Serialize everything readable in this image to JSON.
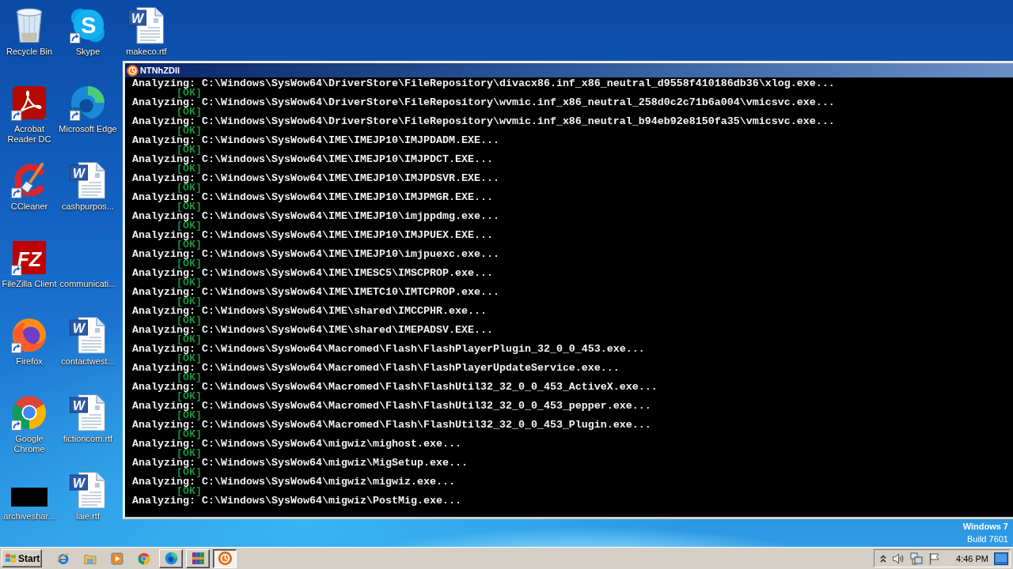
{
  "desktop": {
    "icon_rows": [
      {
        "icons": [
          {
            "kind": "recycle-bin",
            "label": "Recycle Bin",
            "shortcut": false,
            "selected": false
          },
          {
            "kind": "skype",
            "label": "Skype",
            "glyph": "S",
            "shortcut": true,
            "selected": false
          },
          {
            "kind": "word-doc",
            "label": "makeco.rtf",
            "glyph": "W",
            "shortcut": false,
            "selected": false
          }
        ]
      },
      {
        "icons": [
          {
            "kind": "acrobat",
            "label": "Acrobat Reader DC",
            "shortcut": true,
            "selected": false
          },
          {
            "kind": "edge",
            "label": "Microsoft Edge",
            "shortcut": true,
            "selected": false
          }
        ]
      },
      {
        "icons": [
          {
            "kind": "ccleaner",
            "label": "CCleaner",
            "shortcut": true,
            "selected": false
          },
          {
            "kind": "word-doc",
            "label": "cashpurpos...",
            "glyph": "W",
            "shortcut": false,
            "selected": false
          }
        ]
      },
      {
        "icons": [
          {
            "kind": "filezilla",
            "label": "FileZilla Client",
            "glyph": "FZ",
            "shortcut": true,
            "selected": false
          },
          {
            "kind": "blank",
            "label": "communicati...",
            "selected": false
          }
        ]
      },
      {
        "icons": [
          {
            "kind": "firefox",
            "label": "Firefox",
            "shortcut": true,
            "selected": false
          },
          {
            "kind": "word-doc",
            "label": "contactwest...",
            "glyph": "W",
            "shortcut": false,
            "selected": false
          }
        ]
      },
      {
        "icons": [
          {
            "kind": "chrome",
            "label": "Google Chrome",
            "shortcut": true,
            "selected": false
          },
          {
            "kind": "word-doc",
            "label": "fictioncom.rtf",
            "glyph": "W",
            "shortcut": false,
            "selected": false
          }
        ]
      },
      {
        "icons": [
          {
            "kind": "thumbnail",
            "label": "archiveshar...",
            "shortcut": false,
            "selected": false
          },
          {
            "kind": "word-doc",
            "label": "laie.rtf",
            "glyph": "W",
            "shortcut": false,
            "selected": false
          }
        ]
      }
    ],
    "system_watermark": {
      "edition": "Windows 7",
      "build": "Build 7601"
    }
  },
  "console_window": {
    "title": "NTNhZDll",
    "lines": [
      {
        "kind": "analysis",
        "text": "Analyzing: C:\\Windows\\SysWow64\\DriverStore\\FileRepository\\divacx86.inf_x86_neutral_d9558f410186db36\\xlog.exe..."
      },
      {
        "kind": "ok",
        "text": "[OK]"
      },
      {
        "kind": "analysis",
        "text": "Analyzing: C:\\Windows\\SysWow64\\DriverStore\\FileRepository\\wvmic.inf_x86_neutral_258d0c2c71b6a004\\vmicsvc.exe..."
      },
      {
        "kind": "ok",
        "text": "[OK]"
      },
      {
        "kind": "analysis",
        "text": "Analyzing: C:\\Windows\\SysWow64\\DriverStore\\FileRepository\\wvmic.inf_x86_neutral_b94eb92e8150fa35\\vmicsvc.exe..."
      },
      {
        "kind": "ok",
        "text": "[OK]"
      },
      {
        "kind": "analysis",
        "text": "Analyzing: C:\\Windows\\SysWow64\\IME\\IMEJP10\\IMJPDADM.EXE..."
      },
      {
        "kind": "ok",
        "text": "[OK]"
      },
      {
        "kind": "analysis",
        "text": "Analyzing: C:\\Windows\\SysWow64\\IME\\IMEJP10\\IMJPDCT.EXE..."
      },
      {
        "kind": "ok",
        "text": "[OK]"
      },
      {
        "kind": "analysis",
        "text": "Analyzing: C:\\Windows\\SysWow64\\IME\\IMEJP10\\IMJPDSVR.EXE..."
      },
      {
        "kind": "ok",
        "text": "[OK]"
      },
      {
        "kind": "analysis",
        "text": "Analyzing: C:\\Windows\\SysWow64\\IME\\IMEJP10\\IMJPMGR.EXE..."
      },
      {
        "kind": "ok",
        "text": "[OK]"
      },
      {
        "kind": "analysis",
        "text": "Analyzing: C:\\Windows\\SysWow64\\IME\\IMEJP10\\imjppdmg.exe..."
      },
      {
        "kind": "ok",
        "text": "[OK]"
      },
      {
        "kind": "analysis",
        "text": "Analyzing: C:\\Windows\\SysWow64\\IME\\IMEJP10\\IMJPUEX.EXE..."
      },
      {
        "kind": "ok",
        "text": "[OK]"
      },
      {
        "kind": "analysis",
        "text": "Analyzing: C:\\Windows\\SysWow64\\IME\\IMEJP10\\imjpuexc.exe..."
      },
      {
        "kind": "ok",
        "text": "[OK]"
      },
      {
        "kind": "analysis",
        "text": "Analyzing: C:\\Windows\\SysWow64\\IME\\IMESC5\\IMSCPROP.exe..."
      },
      {
        "kind": "ok",
        "text": "[OK]"
      },
      {
        "kind": "analysis",
        "text": "Analyzing: C:\\Windows\\SysWow64\\IME\\IMETC10\\IMTCPROP.exe..."
      },
      {
        "kind": "ok",
        "text": "[OK]"
      },
      {
        "kind": "analysis",
        "text": "Analyzing: C:\\Windows\\SysWow64\\IME\\shared\\IMCCPHR.exe..."
      },
      {
        "kind": "ok",
        "text": "[OK]"
      },
      {
        "kind": "analysis",
        "text": "Analyzing: C:\\Windows\\SysWow64\\IME\\shared\\IMEPADSV.EXE..."
      },
      {
        "kind": "ok",
        "text": "[OK]"
      },
      {
        "kind": "analysis",
        "text": "Analyzing: C:\\Windows\\SysWow64\\Macromed\\Flash\\FlashPlayerPlugin_32_0_0_453.exe..."
      },
      {
        "kind": "ok",
        "text": "[OK]"
      },
      {
        "kind": "analysis",
        "text": "Analyzing: C:\\Windows\\SysWow64\\Macromed\\Flash\\FlashPlayerUpdateService.exe..."
      },
      {
        "kind": "ok",
        "text": "[OK]"
      },
      {
        "kind": "analysis",
        "text": "Analyzing: C:\\Windows\\SysWow64\\Macromed\\Flash\\FlashUtil32_32_0_0_453_ActiveX.exe..."
      },
      {
        "kind": "ok",
        "text": "[OK]"
      },
      {
        "kind": "analysis",
        "text": "Analyzing: C:\\Windows\\SysWow64\\Macromed\\Flash\\FlashUtil32_32_0_0_453_pepper.exe..."
      },
      {
        "kind": "ok",
        "text": "[OK]"
      },
      {
        "kind": "analysis",
        "text": "Analyzing: C:\\Windows\\SysWow64\\Macromed\\Flash\\FlashUtil32_32_0_0_453_Plugin.exe..."
      },
      {
        "kind": "ok",
        "text": "[OK]"
      },
      {
        "kind": "analysis",
        "text": "Analyzing: C:\\Windows\\SysWow64\\migwiz\\mighost.exe..."
      },
      {
        "kind": "ok",
        "text": "[OK]"
      },
      {
        "kind": "analysis",
        "text": "Analyzing: C:\\Windows\\SysWow64\\migwiz\\MigSetup.exe..."
      },
      {
        "kind": "ok",
        "text": "[OK]"
      },
      {
        "kind": "analysis",
        "text": "Analyzing: C:\\Windows\\SysWow64\\migwiz\\migwiz.exe..."
      },
      {
        "kind": "ok",
        "text": "[OK]"
      },
      {
        "kind": "analysis",
        "text": "Analyzing: C:\\Windows\\SysWow64\\migwiz\\PostMig.exe..."
      }
    ]
  },
  "taskbar": {
    "start_label": "Start",
    "task_buttons": [
      {
        "kind": "edge",
        "selected": false
      },
      {
        "kind": "winrar",
        "selected": false
      },
      {
        "kind": "app",
        "selected": true
      }
    ],
    "clock": "4:46 PM"
  }
}
